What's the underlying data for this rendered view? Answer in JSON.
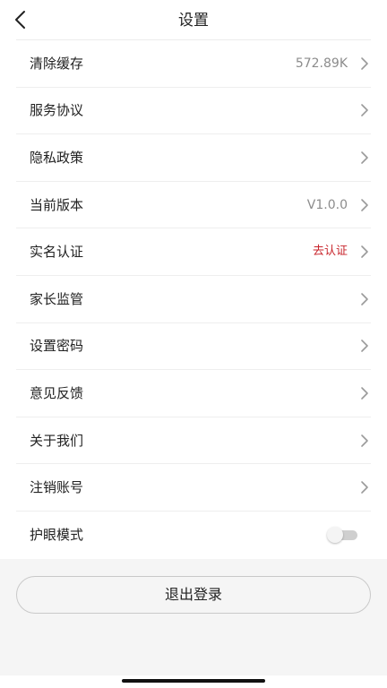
{
  "header": {
    "title": "设置",
    "back_icon": "chevron-left-icon"
  },
  "settings": {
    "items": [
      {
        "label": "清除缓存",
        "value": "572.89K",
        "type": "chevron"
      },
      {
        "label": "服务协议",
        "value": "",
        "type": "chevron"
      },
      {
        "label": "隐私政策",
        "value": "",
        "type": "chevron"
      },
      {
        "label": "当前版本",
        "value": "V1.0.0",
        "type": "chevron"
      },
      {
        "label": "实名认证",
        "value": "去认证",
        "type": "chevron",
        "value_color": "#c8252c"
      },
      {
        "label": "家长监管",
        "value": "",
        "type": "chevron"
      },
      {
        "label": "设置密码",
        "value": "",
        "type": "chevron"
      },
      {
        "label": "意见反馈",
        "value": "",
        "type": "chevron"
      },
      {
        "label": "关于我们",
        "value": "",
        "type": "chevron"
      },
      {
        "label": "注销账号",
        "value": "",
        "type": "chevron"
      },
      {
        "label": "护眼模式",
        "value": "",
        "type": "toggle",
        "toggle_on": false
      }
    ]
  },
  "footer": {
    "logout_label": "退出登录"
  },
  "colors": {
    "text": "#222222",
    "secondary_text": "#8c8c8c",
    "alert": "#c8252c",
    "divider": "#eeeeee",
    "footer_bg": "#f5f5f5"
  }
}
